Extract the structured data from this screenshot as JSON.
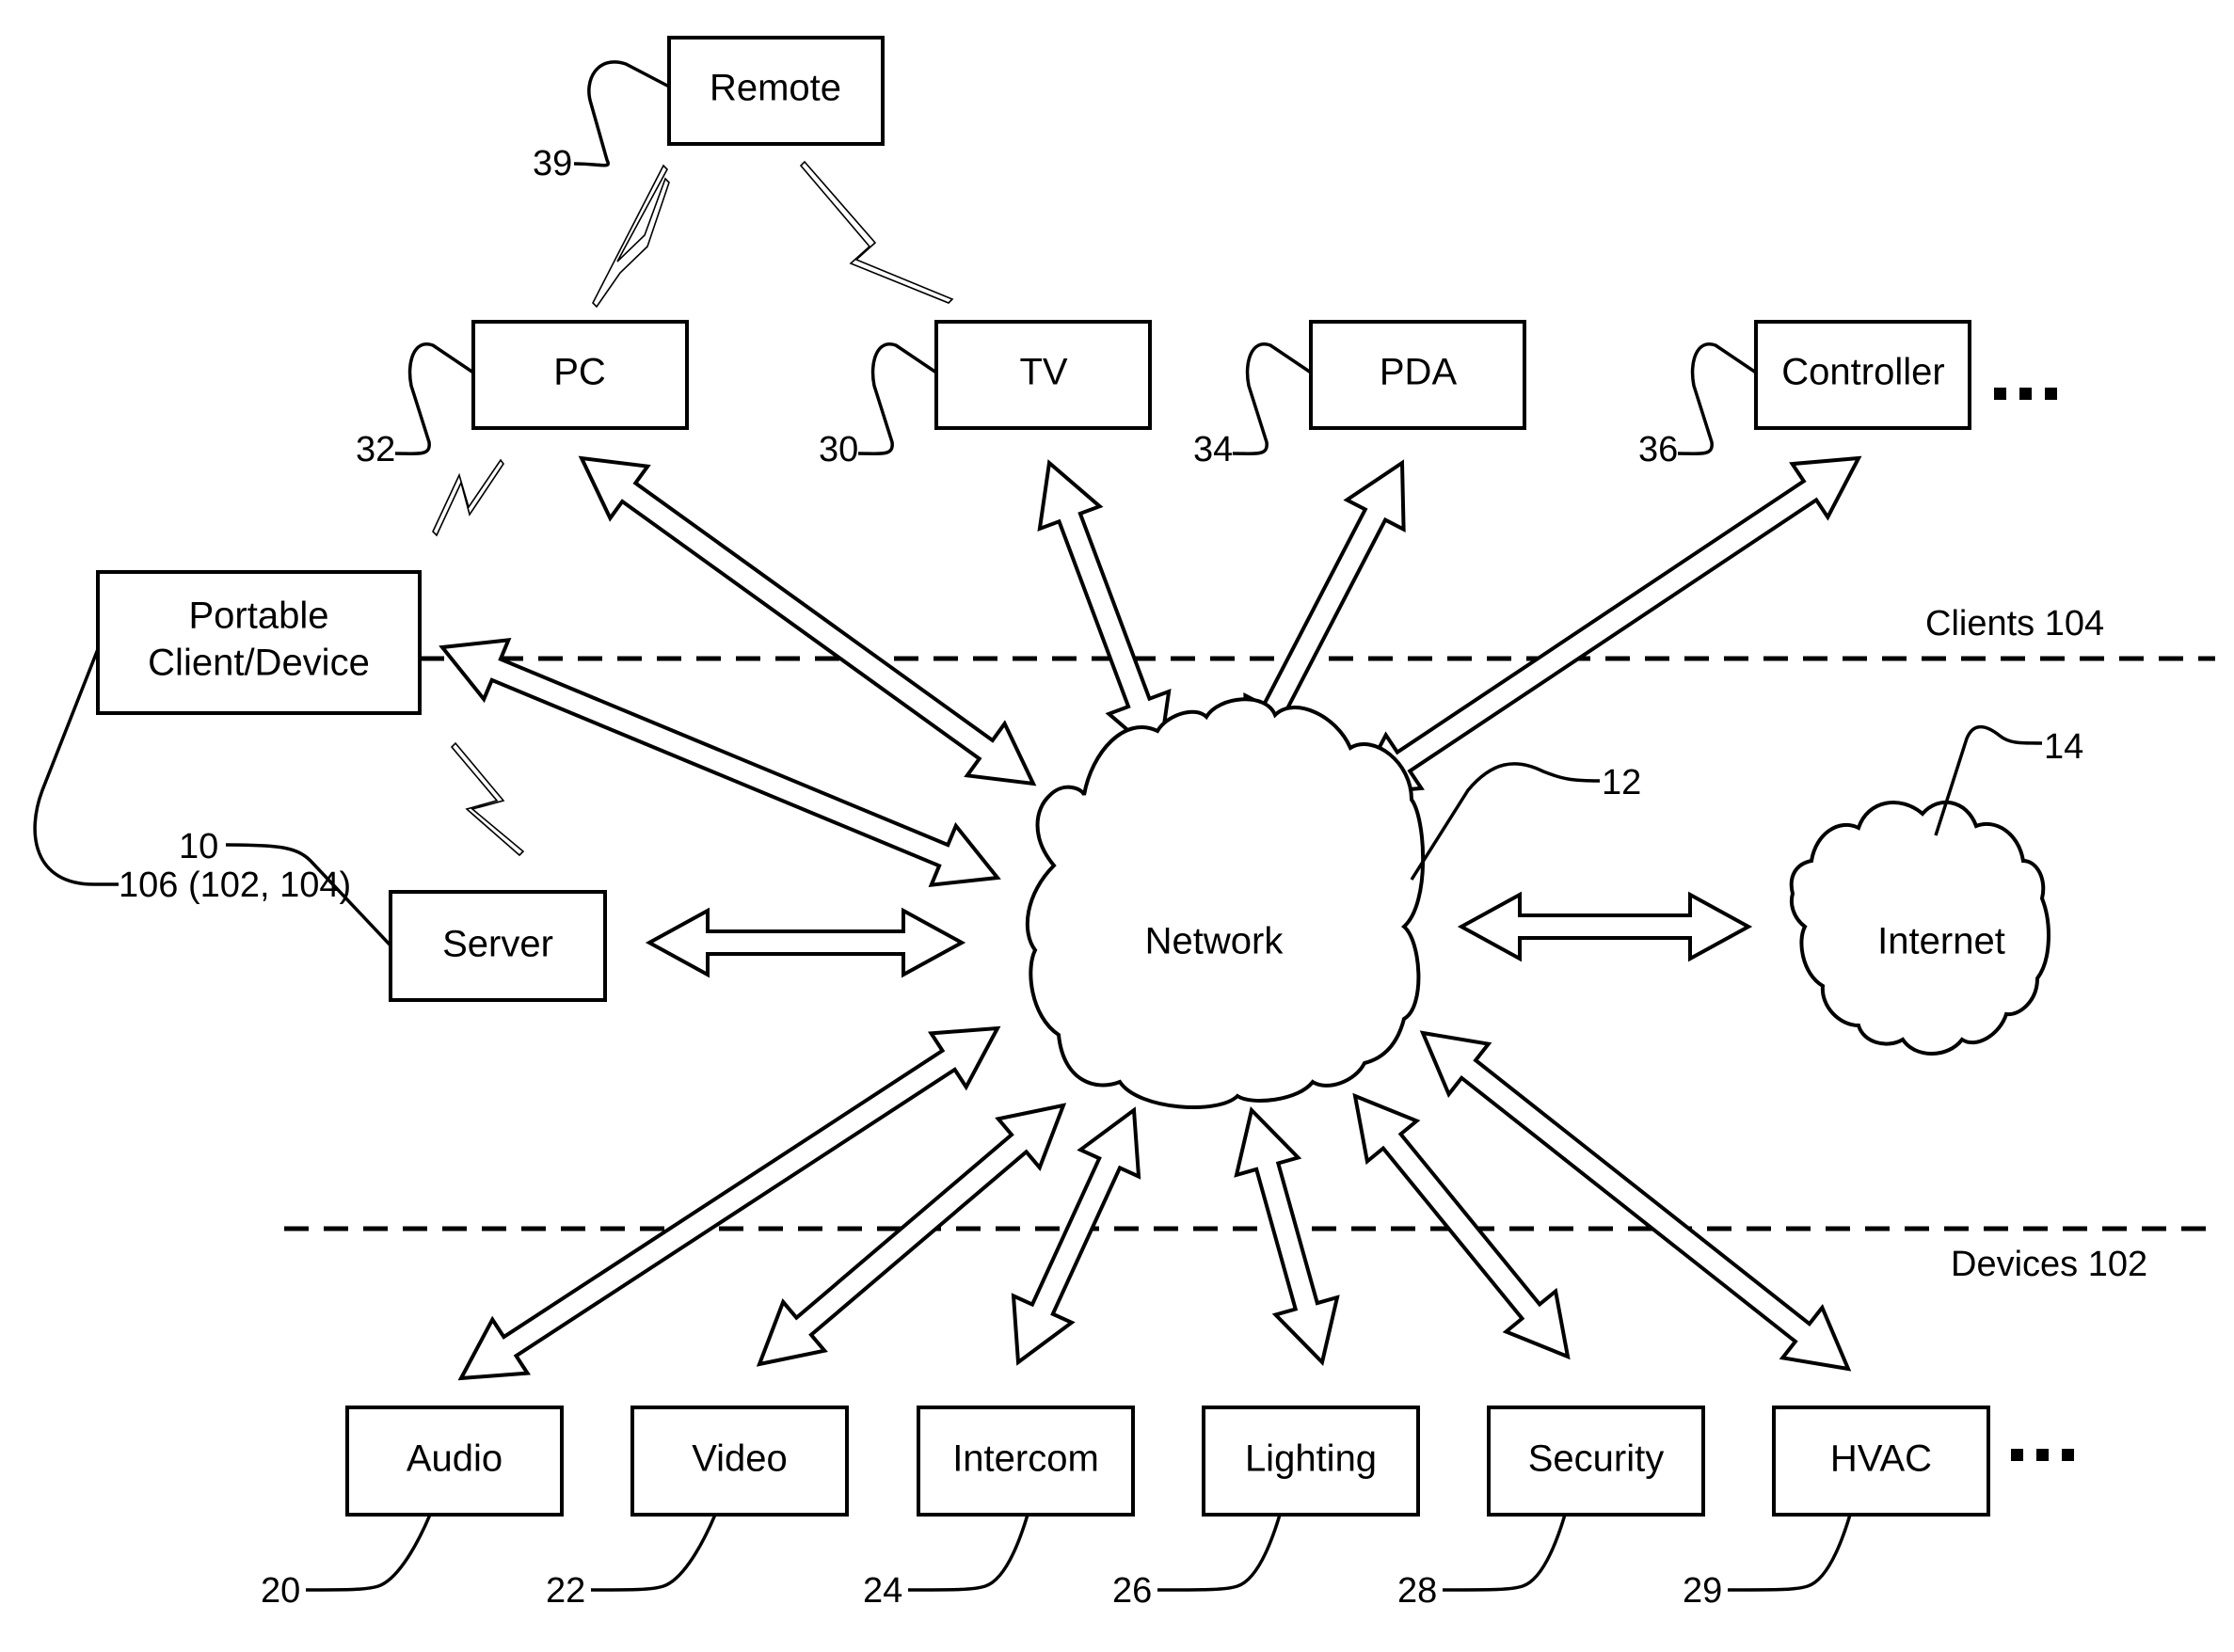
{
  "diagram": {
    "type": "network topology (patent figure)",
    "tiers": {
      "clients_label": "Clients 104",
      "devices_label": "Devices 102"
    },
    "nodes": {
      "remote": {
        "label": "Remote",
        "ref": "39"
      },
      "pc": {
        "label": "PC",
        "ref": "32"
      },
      "tv": {
        "label": "TV",
        "ref": "30"
      },
      "pda": {
        "label": "PDA",
        "ref": "34"
      },
      "controller": {
        "label": "Controller",
        "ref": "36"
      },
      "portable": {
        "label_line1": "Portable",
        "label_line2": "Client/Device",
        "ref": "106 (102, 104)"
      },
      "server": {
        "label": "Server",
        "ref": "10"
      },
      "network": {
        "label": "Network",
        "ref": "12"
      },
      "internet": {
        "label": "Internet",
        "ref": "14"
      },
      "audio": {
        "label": "Audio",
        "ref": "20"
      },
      "video": {
        "label": "Video",
        "ref": "22"
      },
      "intercom": {
        "label": "Intercom",
        "ref": "24"
      },
      "lighting": {
        "label": "Lighting",
        "ref": "26"
      },
      "security": {
        "label": "Security",
        "ref": "28"
      },
      "hvac": {
        "label": "HVAC",
        "ref": "29"
      }
    },
    "ellipsis": "...",
    "wireless_links": [
      {
        "from": "Remote",
        "to": "PC"
      },
      {
        "from": "Remote",
        "to": "TV"
      },
      {
        "from": "PC",
        "to": "Portable Client/Device"
      },
      {
        "from": "Portable Client/Device",
        "to": "Server"
      }
    ],
    "bidirectional_links": [
      {
        "from": "PC",
        "to": "Network"
      },
      {
        "from": "TV",
        "to": "Network"
      },
      {
        "from": "PDA",
        "to": "Network"
      },
      {
        "from": "Controller",
        "to": "Network"
      },
      {
        "from": "Portable Client/Device",
        "to": "Network"
      },
      {
        "from": "Server",
        "to": "Network"
      },
      {
        "from": "Network",
        "to": "Internet"
      },
      {
        "from": "Audio",
        "to": "Network"
      },
      {
        "from": "Video",
        "to": "Network"
      },
      {
        "from": "Intercom",
        "to": "Network"
      },
      {
        "from": "Lighting",
        "to": "Network"
      },
      {
        "from": "Security",
        "to": "Network"
      },
      {
        "from": "HVAC",
        "to": "Network"
      }
    ]
  }
}
